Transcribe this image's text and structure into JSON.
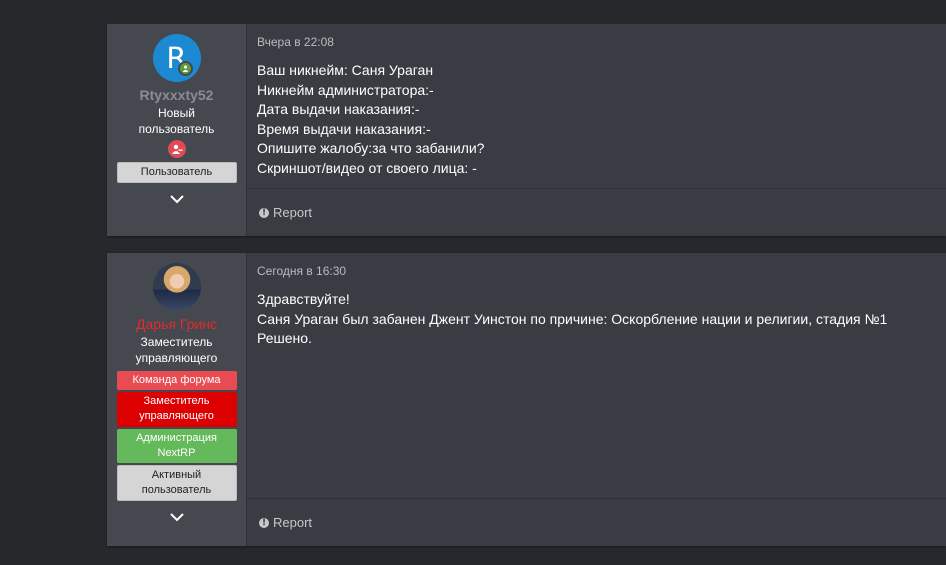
{
  "posts": [
    {
      "avatar_letter": "R",
      "username": "Rtyxxxty52",
      "user_title": "Новый пользователь",
      "banners": [
        "Пользователь"
      ],
      "date": "Вчера в 22:08",
      "lines": [
        "Ваш никнейм: Саня Ураган",
        "Никнейм администратора:-",
        "Дата выдачи наказания:-",
        "Время выдачи наказания:-",
        "Опишите жалобу:за что забанили?",
        "Скриншот/видео от своего лица: -"
      ],
      "report_label": "Report"
    },
    {
      "username": "Дарья Гринс",
      "user_title": "Заместитель управляющего",
      "banners": [
        "Команда форума",
        "Заместитель управляющего",
        "Администрация NextRP",
        "Активный пользователь"
      ],
      "date": "Сегодня в 16:30",
      "lines": [
        "Здравствуйте!",
        "Саня Ураган был забанен Джент Уинстон по причине: Оскорбление нации и религии, стадия №1",
        "Решено."
      ],
      "report_label": "Report"
    }
  ],
  "colors": {
    "background": "#26282c",
    "post_bg": "#393c42",
    "user_col_bg": "#45484e",
    "staff_name": "#e22b2b",
    "banner_team": "#e84c52",
    "banner_deputy": "#dd0000",
    "banner_admin": "#64b95a"
  },
  "icons": {
    "online": "online-indicator-icon",
    "ban": "user-warning-icon",
    "expand": "chevron-down-icon",
    "report": "info-circle-icon"
  }
}
